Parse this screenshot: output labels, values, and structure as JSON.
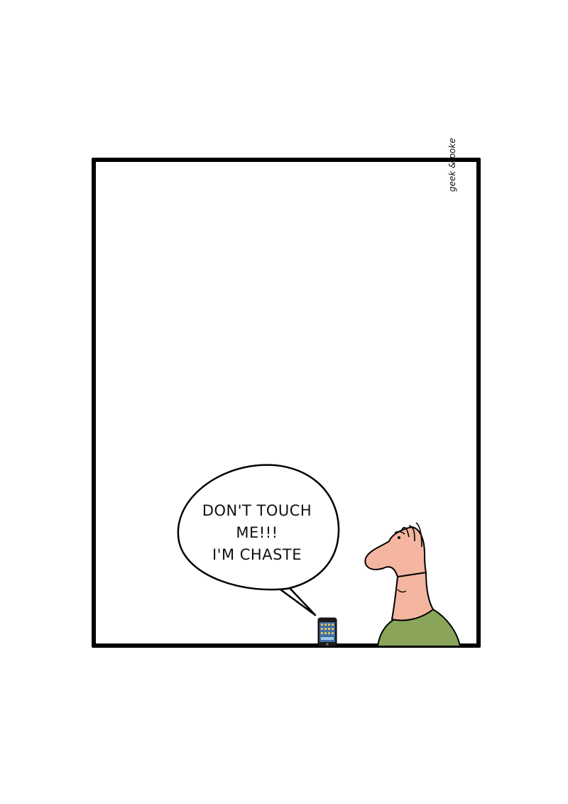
{
  "comic": {
    "signature": "geek & poke",
    "speech_lines": [
      "DON'T TOUCH",
      "ME!!!",
      "I'M CHASTE"
    ]
  },
  "colors": {
    "frame": "#000000",
    "skin": "#f4b6a0",
    "shirt": "#8aa55a",
    "phone_body": "#1b1b1b",
    "phone_screen": "#3c6fa6"
  },
  "icons": {
    "phone": "smartphone-icon",
    "character": "man-character"
  }
}
